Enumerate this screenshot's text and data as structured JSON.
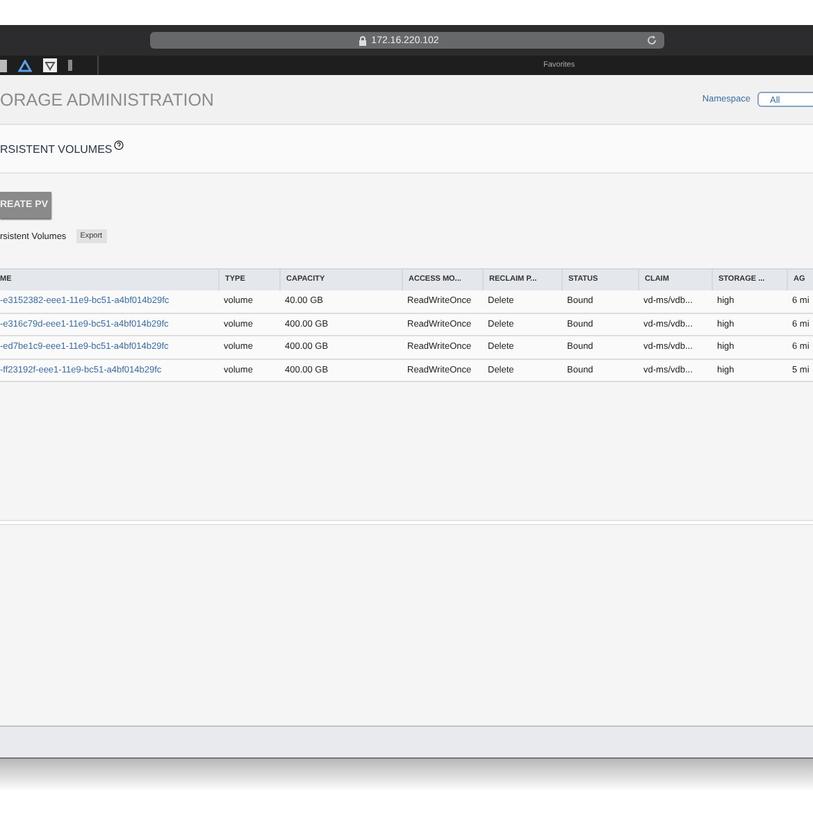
{
  "browser": {
    "address": "172.16.220.102",
    "bookmarks_label": "Favorites"
  },
  "header": {
    "title": "ORAGE ADMINISTRATION",
    "namespace_label": "Namespace",
    "namespace_value": "All"
  },
  "section": {
    "title": "RSISTENT VOLUMES",
    "create_button": "REATE PV",
    "list_label": "rsistent Volumes",
    "export_button": "Export"
  },
  "table": {
    "columns": [
      "ME",
      "TYPE",
      "CAPACITY",
      "ACCESS MO...",
      "RECLAIM P...",
      "STATUS",
      "CLAIM",
      "STORAGE ...",
      "AG"
    ],
    "rows": [
      [
        "-e3152382-eee1-11e9-bc51-a4bf014b29fc",
        "volume",
        "40.00 GB",
        "ReadWriteOnce",
        "Delete",
        "Bound",
        "vd-ms/vdb...",
        "high",
        "6 mi"
      ],
      [
        "-e316c79d-eee1-11e9-bc51-a4bf014b29fc",
        "volume",
        "400.00 GB",
        "ReadWriteOnce",
        "Delete",
        "Bound",
        "vd-ms/vdb...",
        "high",
        "6 mi"
      ],
      [
        "-ed7be1c9-eee1-11e9-bc51-a4bf014b29fc",
        "volume",
        "400.00 GB",
        "ReadWriteOnce",
        "Delete",
        "Bound",
        "vd-ms/vdb...",
        "high",
        "6 mi"
      ],
      [
        "-ff23192f-eee1-11e9-bc51-a4bf014b29fc",
        "volume",
        "400.00 GB",
        "ReadWriteOnce",
        "Delete",
        "Bound",
        "vd-ms/vdb...",
        "high",
        "5 mi"
      ]
    ]
  }
}
